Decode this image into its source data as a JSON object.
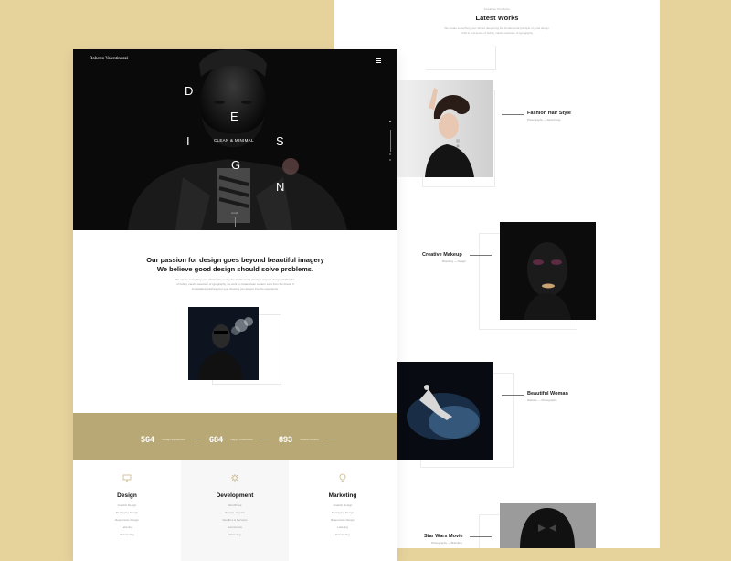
{
  "brand": {
    "name": "Roberto Valentinuzzi"
  },
  "hero": {
    "letters": [
      "D",
      "E",
      "S",
      "I",
      "G",
      "N"
    ],
    "tagline": "CLEAN & MINIMAL",
    "scroll_label": "scroll"
  },
  "about": {
    "heading_line1": "Our passion for design goes beyond beautiful imagery",
    "heading_line2": "We believe good design should solve problems.",
    "body_line1": "We create something your vibrant deepening the fundamental principle of good design. Craft is the",
    "body_line2": "of hobby, careful selection of typography, we work to create clean modern sites from the brand. It",
    "body_line3": "immediately catches your eye, showing you deeper into the experience."
  },
  "stats": [
    {
      "number": "564",
      "label": "Design Experience"
    },
    {
      "number": "684",
      "label": "Happy Customers"
    },
    {
      "number": "893",
      "label": "Awards Winner"
    }
  ],
  "services": [
    {
      "title": "Design",
      "items": [
        "Graphic Design",
        "Packaging Design",
        "Responsive Design",
        "Lettering",
        "Rebranding"
      ]
    },
    {
      "title": "Development",
      "items": [
        "WordPress",
        "Reactjs, Angular",
        "Sandbox & Services",
        "Ecommerce",
        "Marketing"
      ]
    },
    {
      "title": "Marketing",
      "items": [
        "Graphic Design",
        "Packaging Design",
        "Responsive Design",
        "Lettering",
        "Rebranding"
      ]
    }
  ],
  "latest": {
    "subtitle": "Creative Portfolio",
    "title": "Latest Works",
    "desc_line1": "We create something your vibrant deepening the fundamental principle of good design.",
    "desc_line2": "Craft is that sense of hobby, careful selection of typography."
  },
  "works": [
    {
      "title": "Fashion Hair Style",
      "tags": "Photography  —  Advertising"
    },
    {
      "title": "Creative Makeup",
      "tags": "Branding  —  Design"
    },
    {
      "title": "Beautiful Woman",
      "tags": "Website  —  Photography"
    },
    {
      "title": "Star Wars Movie",
      "tags": "Photography  —  Branding"
    }
  ],
  "colors": {
    "accent": "#b8a875",
    "background": "#e6d29b",
    "hero": "#0a0a0a"
  },
  "icons": [
    "menu-icon",
    "monitor-icon",
    "gear-icon",
    "bulb-icon"
  ]
}
